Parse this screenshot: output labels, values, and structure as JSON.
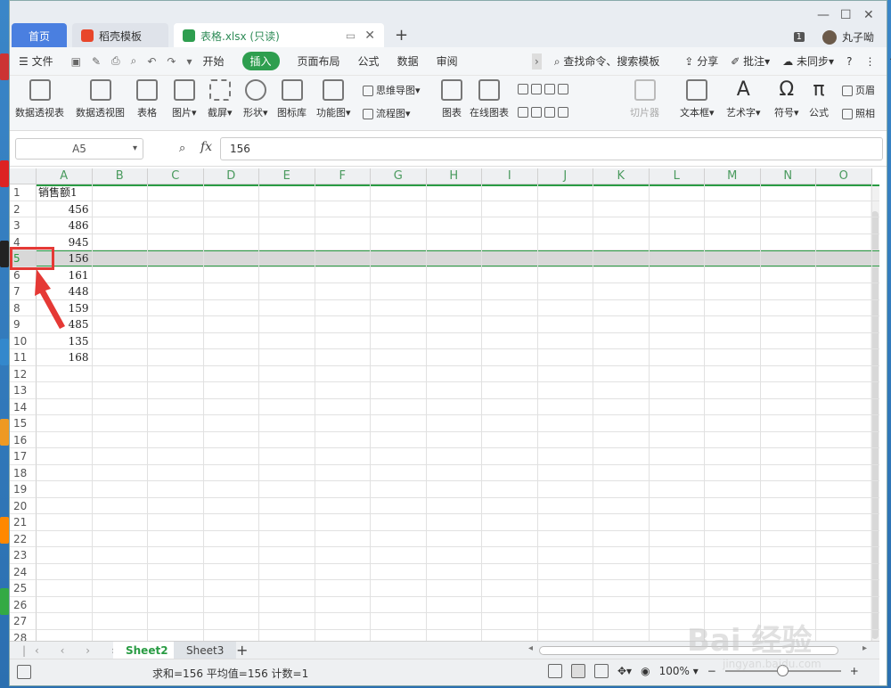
{
  "tabs": {
    "home": "首页",
    "template": "稻壳模板",
    "file": "表格.xlsx (只读)"
  },
  "user": {
    "name": "丸子呦",
    "badge": "1"
  },
  "menu": {
    "file": "文件",
    "items": [
      "开始",
      "插入",
      "页面布局",
      "公式",
      "数据",
      "审阅"
    ],
    "active": "插入",
    "search": "查找命令、搜索模板",
    "share": "分享",
    "comment": "批注",
    "sync": "未同步"
  },
  "ribbon": {
    "pivot_table": "数据透视表",
    "pivot_chart": "数据透视图",
    "table": "表格",
    "picture": "图片",
    "screenshot": "截屏",
    "shape": "形状",
    "icon_lib": "图标库",
    "func_chart": "功能图",
    "mindmap": "思维导图",
    "flowchart": "流程图",
    "chart": "图表",
    "online_chart": "在线图表",
    "slicer": "切片器",
    "textbox": "文本框",
    "wordart": "艺术字",
    "symbol": "符号",
    "formula": "公式",
    "header": "页眉",
    "camera": "照相"
  },
  "formula_bar": {
    "cell_ref": "A5",
    "fx": "fx",
    "value": "156"
  },
  "columns": [
    "A",
    "B",
    "C",
    "D",
    "E",
    "F",
    "G",
    "H",
    "I",
    "J",
    "K",
    "L",
    "M",
    "N",
    "O"
  ],
  "rows": [
    "1",
    "2",
    "3",
    "4",
    "5",
    "6",
    "7",
    "8",
    "9",
    "10",
    "11",
    "12",
    "13",
    "14",
    "15",
    "16",
    "17",
    "18",
    "19",
    "20",
    "21",
    "22",
    "23",
    "24",
    "25",
    "26",
    "27",
    "28"
  ],
  "cells": {
    "a1": "销售额1",
    "values": [
      "456",
      "486",
      "945",
      "156",
      "161",
      "448",
      "159",
      "485",
      "135",
      "168"
    ]
  },
  "selected_row": "5",
  "sheets": {
    "active": "Sheet2",
    "other": "Sheet3"
  },
  "status": {
    "summary": "求和=156  平均值=156  计数=1",
    "zoom": "100%"
  },
  "watermark": {
    "main": "Bai 经验",
    "sub": "jingyan.baidu.com"
  },
  "colors": {
    "accent": "#2a9c44",
    "highlight_box": "#e53935",
    "home_tab": "#4a7fe0"
  }
}
